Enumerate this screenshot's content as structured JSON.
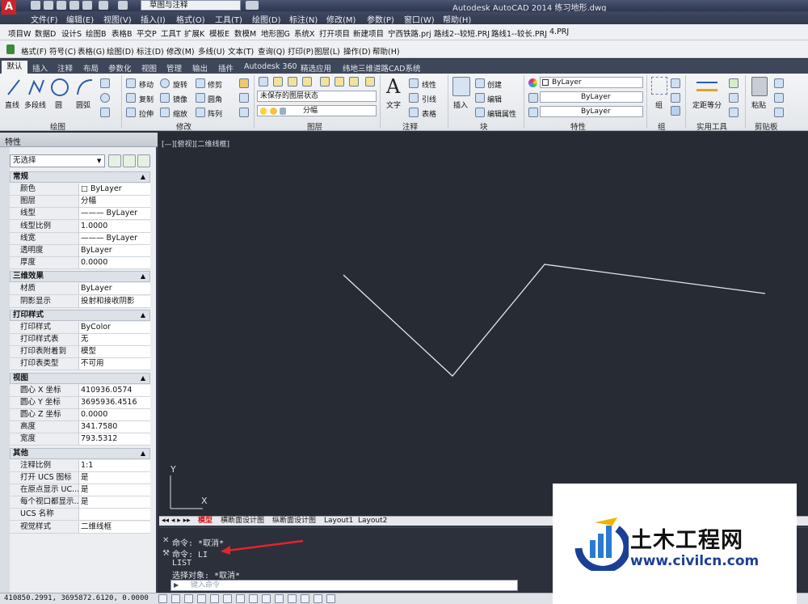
{
  "titlebar": {
    "app_letter": "A",
    "workspace": "草图与注释",
    "title": "Autodesk AutoCAD 2014    练习地形.dwg"
  },
  "menubar": {
    "items": [
      "文件(F)",
      "编辑(E)",
      "视图(V)",
      "插入(I)",
      "格式(O)",
      "工具(T)",
      "绘图(D)",
      "标注(N)",
      "修改(M)",
      "参数(P)",
      "窗口(W)",
      "帮助(H)"
    ]
  },
  "toolbar1": {
    "items": [
      "项目W",
      "数据D",
      "设计S",
      "绘图B",
      "表格B",
      "平交P",
      "工具T",
      "扩展K",
      "模板E",
      "数模M",
      "地形图G",
      "系统X",
      "打开项目",
      "新建项目",
      "宁西铁路.prj",
      "路线2--较短.PRJ",
      "路线1--较长.PRJ",
      "4.PRJ"
    ]
  },
  "toolbar2": {
    "items": [
      "格式(F)",
      "符号(C)",
      "表格(G)",
      "绘图(D)",
      "标注(D)",
      "修改(M)",
      "多线(U)",
      "文本(T)",
      "查询(Q)",
      "打印(P)",
      "图层(L)",
      "操作(D)",
      "帮助(H)"
    ]
  },
  "ribbon_tabs": {
    "active": "默认",
    "items": [
      "插入",
      "注释",
      "布局",
      "参数化",
      "视图",
      "管理",
      "输出",
      "插件",
      "Autodesk 360",
      "精选应用",
      "纬地三维道路CAD系统"
    ]
  },
  "ribbon": {
    "draw": {
      "line": "直线",
      "polyline": "多段线",
      "circle": "圆",
      "arc": "圆弧",
      "title": "绘图"
    },
    "modify": {
      "move": "移动",
      "rotate": "旋转",
      "trim": "修剪",
      "copy": "复制",
      "mirror": "镜像",
      "fillet": "圆角",
      "stretch": "拉伸",
      "scale": "缩放",
      "array": "阵列",
      "title": "修改"
    },
    "layers": {
      "state": "未保存的图层状态",
      "current": "分幅",
      "title": "图层"
    },
    "annotation": {
      "text": "文字",
      "linear": "线性",
      "leader": "引线",
      "table": "表格",
      "title": "注释"
    },
    "block": {
      "insert": "插入",
      "create": "创建",
      "edit": "编辑",
      "edit_attr": "编辑属性",
      "title": "块"
    },
    "properties": {
      "color": "ByLayer",
      "linetype": "ByLayer",
      "lineweight": "ByLayer",
      "title": "特性"
    },
    "group": {
      "group": "组",
      "title": "组"
    },
    "utilities": {
      "measure": "定距等分",
      "title": "实用工具"
    },
    "clipboard": {
      "paste": "粘贴",
      "title": "剪贴板"
    }
  },
  "properties": {
    "title": "特性",
    "selection": "无选择",
    "sections": [
      {
        "name": "常规",
        "rows": [
          [
            "颜色",
            "□ ByLayer"
          ],
          [
            "图层",
            "分幅"
          ],
          [
            "线型",
            "——— ByLayer"
          ],
          [
            "线型比例",
            "1.0000"
          ],
          [
            "线宽",
            "——— ByLayer"
          ],
          [
            "透明度",
            "ByLayer"
          ],
          [
            "厚度",
            "0.0000"
          ]
        ]
      },
      {
        "name": "三维效果",
        "rows": [
          [
            "材质",
            "ByLayer"
          ],
          [
            "阴影显示",
            "投射和接收阴影"
          ]
        ]
      },
      {
        "name": "打印样式",
        "rows": [
          [
            "打印样式",
            "ByColor"
          ],
          [
            "打印样式表",
            "无"
          ],
          [
            "打印表附着到",
            "模型"
          ],
          [
            "打印表类型",
            "不可用"
          ]
        ]
      },
      {
        "name": "视图",
        "rows": [
          [
            "圆心 X 坐标",
            "410936.0574"
          ],
          [
            "圆心 Y 坐标",
            "3695936.4516"
          ],
          [
            "圆心 Z 坐标",
            "0.0000"
          ],
          [
            "高度",
            "341.7580"
          ],
          [
            "宽度",
            "793.5312"
          ]
        ]
      },
      {
        "name": "其他",
        "rows": [
          [
            "注释比例",
            "1:1"
          ],
          [
            "打开 UCS 图标",
            "是"
          ],
          [
            "在原点显示 UC...",
            "是"
          ],
          [
            "每个视口都显示...",
            "是"
          ],
          [
            "UCS 名称",
            ""
          ],
          [
            "视觉样式",
            "二维线框"
          ]
        ]
      }
    ]
  },
  "canvas": {
    "view_label": "[—][俯视][二维线框]",
    "ucs_x": "X",
    "ucs_y": "Y"
  },
  "layout_tabs": {
    "items": [
      "模型",
      "横断面设计图",
      "纵断面设计图",
      "Layout1",
      "Layout2"
    ],
    "active": "模型"
  },
  "command": {
    "lines": [
      "命令: *取消*",
      "命令: LI",
      "LIST",
      "选择对象: *取消*"
    ],
    "placeholder": "键入命令"
  },
  "status": {
    "coords": "410850.2991, 3695872.6120, 0.0000"
  },
  "watermark": {
    "title": "土木工程网",
    "url": "www.civilcn.com"
  }
}
